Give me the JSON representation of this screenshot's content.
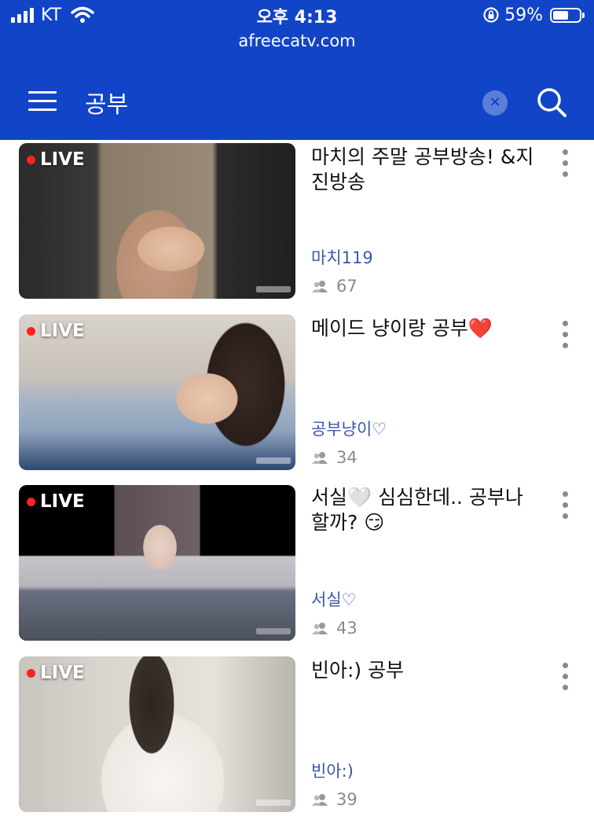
{
  "status_bar": {
    "carrier": "KT",
    "time": "오후 4:13",
    "battery": "59%",
    "battery_level": 0.59,
    "url": "afreecatv.com"
  },
  "header": {
    "search_term": "공부",
    "clear_label": "×"
  },
  "live_label": "LIVE",
  "items": [
    {
      "title": "마치의 주말 공부방송! &지진방송",
      "streamer": "마치119",
      "viewers": "67",
      "thumb_colors": [
        "#6a5a4a",
        "#c9a58c",
        "#2b2b2b"
      ]
    },
    {
      "title": "메이드 냥이랑 공부❤️",
      "streamer": "공부냥이♡",
      "viewers": "34",
      "thumb_colors": [
        "#cfc7bf",
        "#9eb0c8",
        "#3a2a24"
      ]
    },
    {
      "title": "서실🤍 심심한데.. 공부나 할까? 😏",
      "streamer": "서실♡",
      "viewers": "43",
      "thumb_colors": [
        "#000000",
        "#c8c2c6",
        "#2a2226"
      ]
    },
    {
      "title": "빈아:) 공부",
      "streamer": "빈아:)",
      "viewers": "39",
      "thumb_colors": [
        "#d8d6d2",
        "#f2efea",
        "#3a302c"
      ]
    }
  ]
}
